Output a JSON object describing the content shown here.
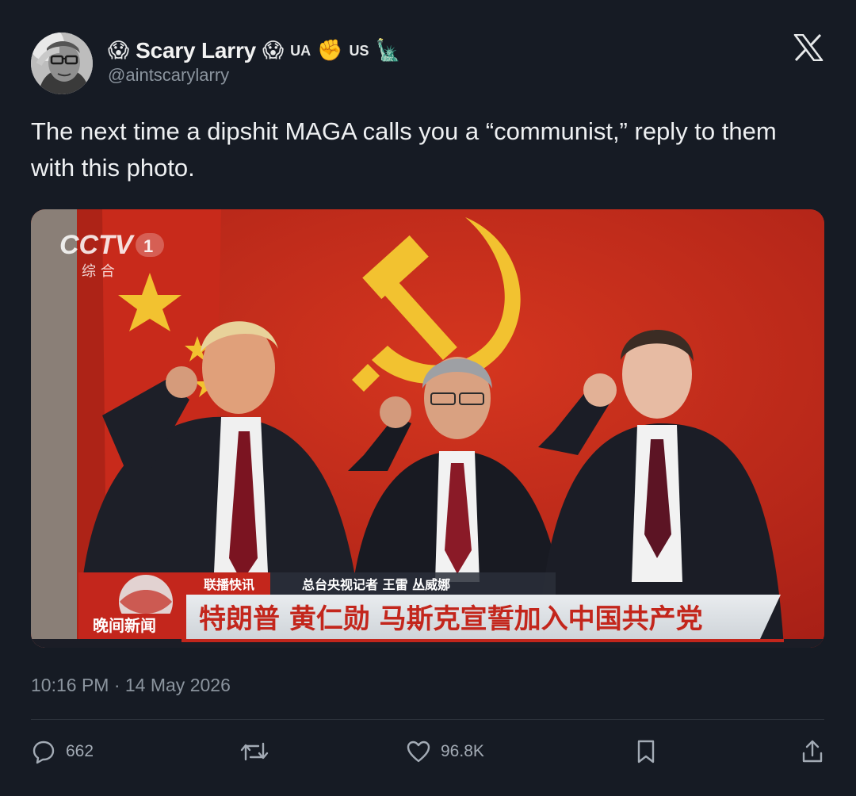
{
  "author": {
    "display_name": "Scary Larry",
    "emoji_left": "😱",
    "emoji_right": "😱",
    "tag_ua": "UA",
    "fist_emoji": "✊",
    "tag_us": "US",
    "statue_emoji": "🗽",
    "handle": "@aintscarylarry"
  },
  "tweet": {
    "text": "The next time a dipshit MAGA calls you a “communist,” reply to them with this photo."
  },
  "media": {
    "channel_logo": "CCTV",
    "channel_number": "1",
    "channel_sub": "综 合",
    "ticker_top_left": "联播快讯",
    "ticker_top_right": "总台央视记者 王雷 丛威娜",
    "program_name": "晚间新闻",
    "headline": "特朗普 黄仁勋 马斯克宣誓加入中国共产党"
  },
  "timestamp": "10:16 PM · 14 May 2026",
  "actions": {
    "reply_count": "662",
    "like_count": "96.8K"
  },
  "colors": {
    "background": "#161b24",
    "text": "#e7e9ea",
    "muted": "#8b949e",
    "banner_red": "#c3261c",
    "flag_yellow": "#f2c230"
  },
  "icons": [
    "x-logo-icon",
    "reply-icon",
    "retweet-icon",
    "like-icon",
    "bookmark-icon",
    "share-icon"
  ]
}
